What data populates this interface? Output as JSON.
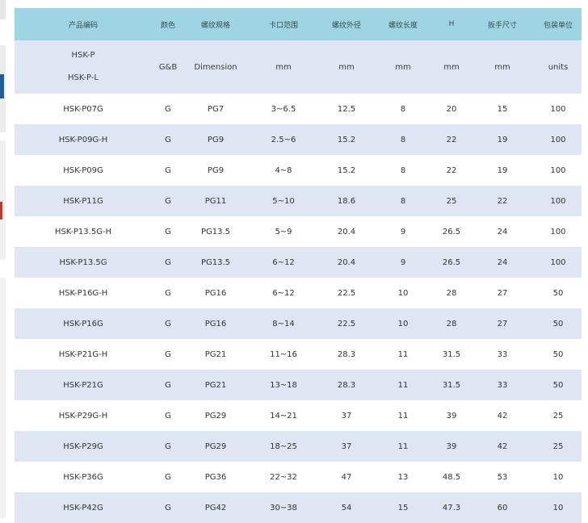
{
  "headers": [
    "产品编码",
    "颜色",
    "螺纹规格",
    "卡口范围",
    "螺纹外径",
    "螺纹长度",
    "H",
    "扳手尺寸",
    "包装单位"
  ],
  "subheader": {
    "model_line1": "HSK-P",
    "model_line2": "HSK-P-L",
    "color": "G&B",
    "thread": "Dimension",
    "clamp_range": "mm",
    "outer_dia": "mm",
    "thread_len": "mm",
    "h": "mm",
    "wrench": "mm",
    "pack": "units"
  },
  "rows": [
    [
      "HSK-P07G",
      "G",
      "PG7",
      "3~6.5",
      "12.5",
      "8",
      "20",
      "15",
      "100"
    ],
    [
      "HSK-P09G-H",
      "G",
      "PG9",
      "2.5~6",
      "15.2",
      "8",
      "22",
      "19",
      "100"
    ],
    [
      "HSK-P09G",
      "G",
      "PG9",
      "4~8",
      "15.2",
      "8",
      "22",
      "19",
      "100"
    ],
    [
      "HSK-P11G",
      "G",
      "PG11",
      "5~10",
      "18.6",
      "8",
      "25",
      "22",
      "100"
    ],
    [
      "HSK-P13.5G-H",
      "G",
      "PG13.5",
      "5~9",
      "20.4",
      "9",
      "26.5",
      "24",
      "100"
    ],
    [
      "HSK-P13.5G",
      "G",
      "PG13.5",
      "6~12",
      "20.4",
      "9",
      "26.5",
      "24",
      "100"
    ],
    [
      "HSK-P16G-H",
      "G",
      "PG16",
      "6~12",
      "22.5",
      "10",
      "28",
      "27",
      "50"
    ],
    [
      "HSK-P16G",
      "G",
      "PG16",
      "8~14",
      "22.5",
      "10",
      "28",
      "27",
      "50"
    ],
    [
      "HSK-P21G-H",
      "G",
      "PG21",
      "11~16",
      "28.3",
      "11",
      "31.5",
      "33",
      "50"
    ],
    [
      "HSK-P21G",
      "G",
      "PG21",
      "13~18",
      "28.3",
      "11",
      "31.5",
      "33",
      "50"
    ],
    [
      "HSK-P29G-H",
      "G",
      "PG29",
      "14~21",
      "37",
      "11",
      "39",
      "42",
      "25"
    ],
    [
      "HSK-P29G",
      "G",
      "PG29",
      "18~25",
      "37",
      "11",
      "39",
      "42",
      "25"
    ],
    [
      "HSK-P36G",
      "G",
      "PG36",
      "22~32",
      "47",
      "13",
      "48.5",
      "53",
      "10"
    ],
    [
      "HSK-P42G",
      "G",
      "PG42",
      "30~38",
      "54",
      "15",
      "47.3",
      "60",
      "10"
    ]
  ],
  "colors": {
    "header_bg": "#9fd4e3",
    "stripe_bg": "#dde6f2",
    "row_bg": "#ffffff",
    "edge_accent_blue": "#1f5c99",
    "edge_accent_red": "#c0392b"
  }
}
